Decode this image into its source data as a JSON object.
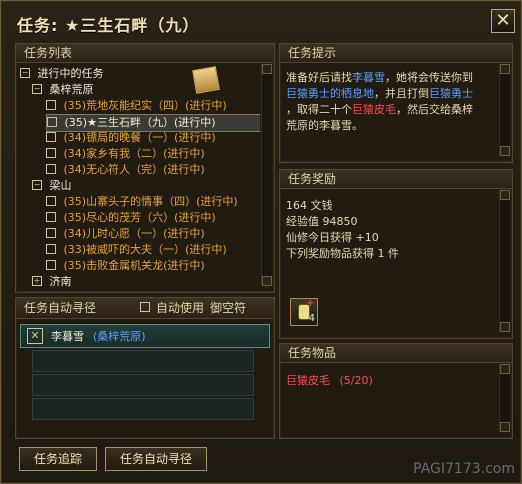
{
  "window": {
    "title": "任务: ★三生石畔（九）",
    "close_label": "✕"
  },
  "task_list": {
    "header": "任务列表",
    "items": [
      {
        "label": "进行中的任务"
      },
      {
        "label": "桑梓荒原"
      },
      {
        "label": "(35)荒地灰能纪实（四）(进行中)"
      },
      {
        "label": "(35)★三生石畔（九）(进行中)"
      },
      {
        "label": "(34)镖局的晚餐（一）(进行中)"
      },
      {
        "label": "(34)家乡有我（二）(进行中)"
      },
      {
        "label": "(34)无心符人（完）(进行中)"
      },
      {
        "label": "梁山"
      },
      {
        "label": "(35)山寨头子的情事（四）(进行中)"
      },
      {
        "label": "(35)尽心的茂芳（六）(进行中)"
      },
      {
        "label": "(34)儿时心愿（一）(进行中)"
      },
      {
        "label": "(33)被威吓的大夫（一）(进行中)"
      },
      {
        "label": "(35)击败金属机关龙(进行中)"
      },
      {
        "label": "济南"
      }
    ]
  },
  "auto_path": {
    "header": "任务自动寻径",
    "checkbox_label": "自动使用",
    "option_label": "御空符",
    "entry_name": "李暮雪",
    "entry_location": "(桑梓荒原)"
  },
  "buttons": {
    "track": "任务追踪",
    "auto": "任务自动寻径"
  },
  "hint": {
    "header": "任务提示",
    "lines": [
      {
        "segs": [
          {
            "t": "准备好后请找",
            "c": "text"
          },
          {
            "t": "李暮雪",
            "c": "blue"
          },
          {
            "t": "，她将会传送你到",
            "c": "text"
          }
        ]
      },
      {
        "segs": [
          {
            "t": "巨猿勇士的栖息地",
            "c": "blue"
          },
          {
            "t": "，并且打倒",
            "c": "text"
          },
          {
            "t": "巨猿勇士",
            "c": "blue"
          }
        ]
      },
      {
        "segs": [
          {
            "t": "，取得二十个",
            "c": "text"
          },
          {
            "t": "巨猿皮毛",
            "c": "red"
          },
          {
            "t": "，然后交给桑梓",
            "c": "text"
          }
        ]
      },
      {
        "segs": [
          {
            "t": "荒原的李暮雪。",
            "c": "text"
          }
        ]
      }
    ]
  },
  "reward": {
    "header": "任务奖励",
    "lines": [
      "164 文钱",
      "经验值 94850",
      "仙修今日获得 +10",
      "下列奖励物品获得 1 件"
    ],
    "item_count": "4"
  },
  "items": {
    "header": "任务物品",
    "name": "巨猿皮毛",
    "progress": "(5/20)"
  },
  "watermark": "PAGI7173.com"
}
